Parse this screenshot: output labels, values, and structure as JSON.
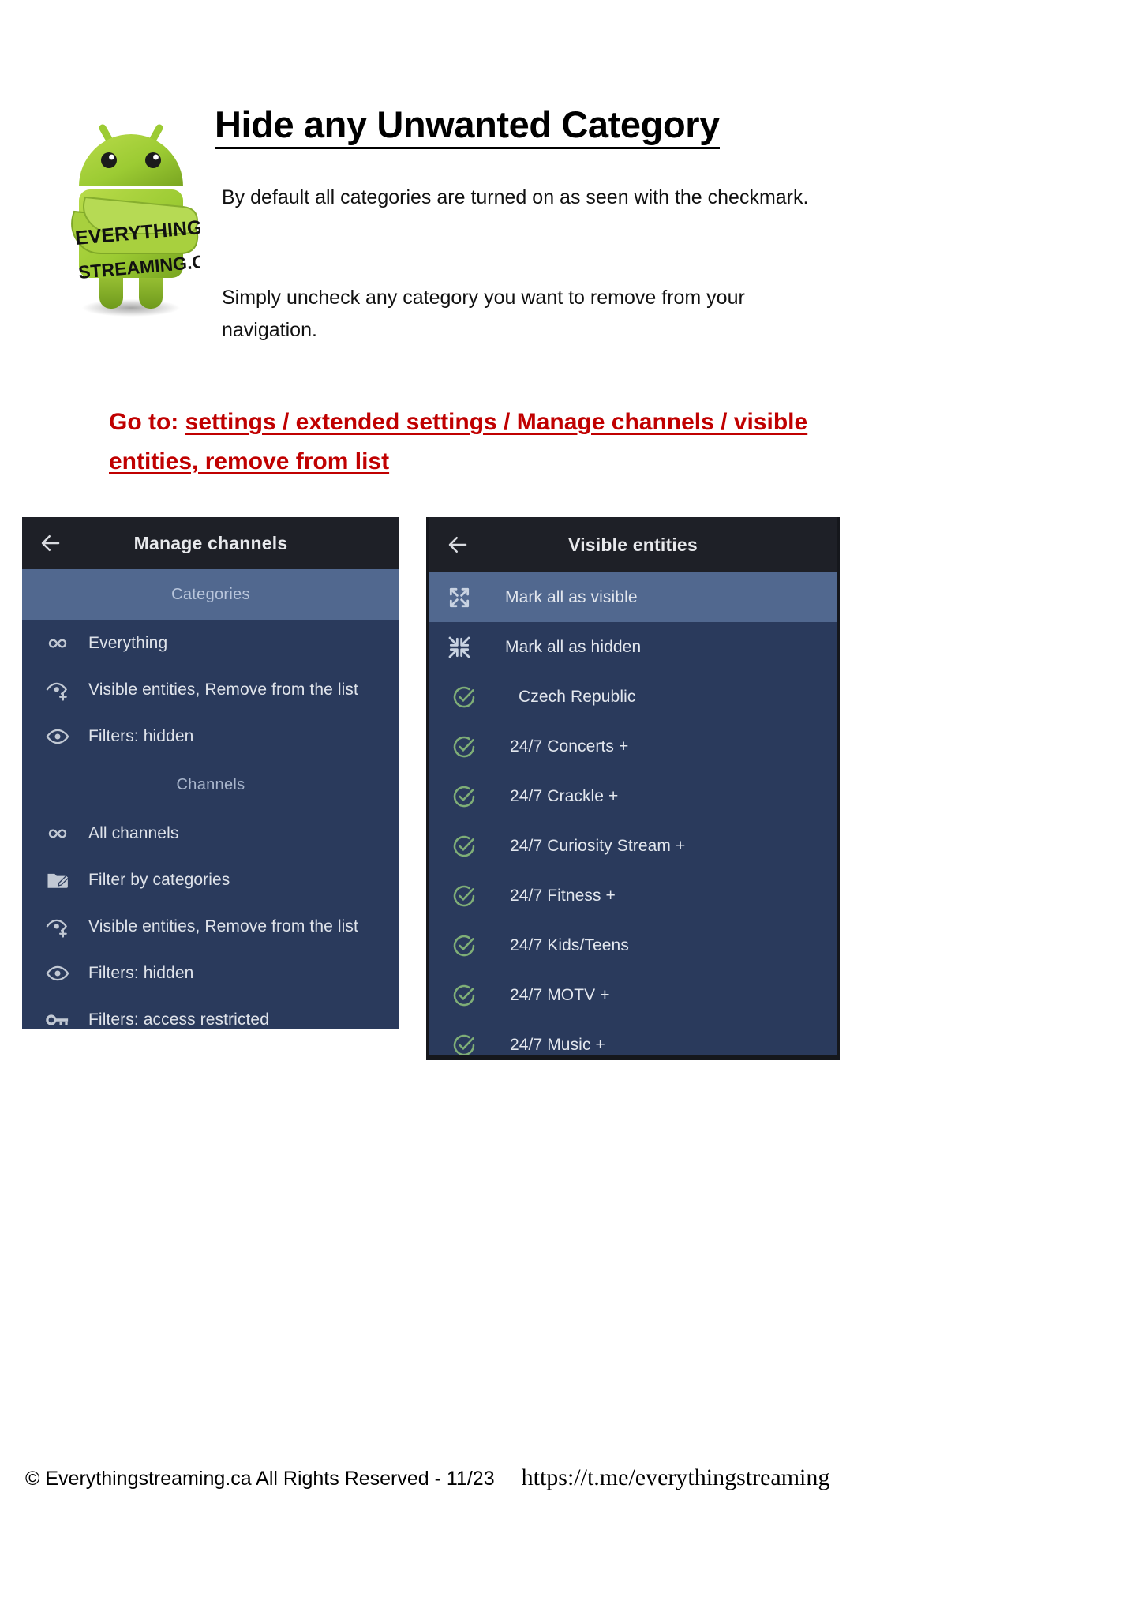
{
  "document": {
    "title": "Hide any Unwanted Category",
    "intro_paragraph_1": "By default all categories are turned on as seen with the checkmark.",
    "intro_paragraph_2": "Simply uncheck any category you want to remove from your navigation.",
    "instruction_prefix": "Go to: ",
    "instruction_path": "settings / extended settings / Manage channels / visible entities, remove from list",
    "instruction_color": "#c00000"
  },
  "logo": {
    "brand_line_1": "EVERYTHING",
    "brand_line_2": "STREAMING.CA",
    "body_color": "#a4c639"
  },
  "screenshot_left": {
    "appbar": {
      "back_icon": "arrow-left-icon",
      "title": "Manage channels"
    },
    "sections": [
      {
        "header": "Categories",
        "highlighted": true,
        "items": [
          {
            "icon": "infinity-icon",
            "label": "Everything"
          },
          {
            "icon": "eye-plus-icon",
            "label": "Visible entities, Remove from the list"
          },
          {
            "icon": "eye-icon",
            "label": "Filters: hidden"
          }
        ]
      },
      {
        "header": "Channels",
        "highlighted": false,
        "items": [
          {
            "icon": "infinity-icon",
            "label": "All channels"
          },
          {
            "icon": "folder-edit-icon",
            "label": "Filter by categories"
          },
          {
            "icon": "eye-plus-icon",
            "label": "Visible entities, Remove from the list"
          },
          {
            "icon": "eye-icon",
            "label": "Filters: hidden"
          },
          {
            "icon": "key-icon",
            "label": "Filters: access restricted"
          }
        ]
      }
    ]
  },
  "screenshot_right": {
    "appbar": {
      "back_icon": "arrow-left-icon",
      "title": "Visible entities"
    },
    "actions": [
      {
        "icon": "expand-icon",
        "label": "Mark all as visible",
        "highlighted": true
      },
      {
        "icon": "collapse-icon",
        "label": "Mark all as hidden",
        "highlighted": false
      }
    ],
    "entities": [
      {
        "icon": "check-circle-icon",
        "label": "Czech Republic",
        "checked": true
      },
      {
        "icon": "check-circle-icon",
        "label": "24/7 Concerts +",
        "checked": true
      },
      {
        "icon": "check-circle-icon",
        "label": "24/7 Crackle +",
        "checked": true
      },
      {
        "icon": "check-circle-icon",
        "label": "24/7 Curiosity Stream +",
        "checked": true
      },
      {
        "icon": "check-circle-icon",
        "label": "24/7 Fitness +",
        "checked": true
      },
      {
        "icon": "check-circle-icon",
        "label": "24/7 Kids/Teens",
        "checked": true
      },
      {
        "icon": "check-circle-icon",
        "label": "24/7 MOTV +",
        "checked": true
      },
      {
        "icon": "check-circle-icon",
        "label": "24/7 Music +",
        "checked": true
      }
    ],
    "check_color": "#7fae77"
  },
  "footer": {
    "copyright": "© Everythingstreaming.ca All Rights Reserved - 11/23",
    "url": "https://t.me/everythingstreaming"
  }
}
